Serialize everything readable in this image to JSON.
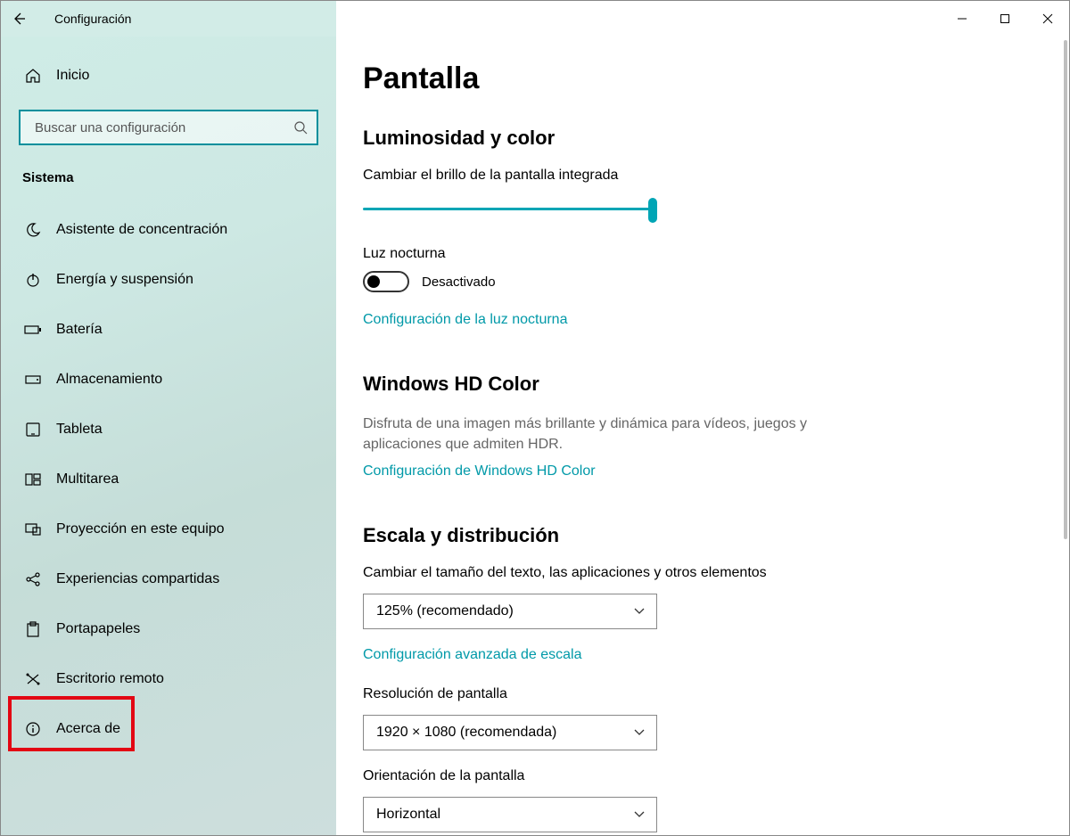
{
  "titlebar": {
    "title": "Configuración"
  },
  "sidebar": {
    "home": "Inicio",
    "search_placeholder": "Buscar una configuración",
    "category": "Sistema",
    "items": [
      {
        "label": "Asistente de concentración"
      },
      {
        "label": "Energía y suspensión"
      },
      {
        "label": "Batería"
      },
      {
        "label": "Almacenamiento"
      },
      {
        "label": "Tableta"
      },
      {
        "label": "Multitarea"
      },
      {
        "label": "Proyección en este equipo"
      },
      {
        "label": "Experiencias compartidas"
      },
      {
        "label": "Portapapeles"
      },
      {
        "label": "Escritorio remoto"
      },
      {
        "label": "Acerca de"
      }
    ]
  },
  "main": {
    "page_title": "Pantalla",
    "sec1": {
      "heading": "Luminosidad y color",
      "brightness_label": "Cambiar el brillo de la pantalla integrada",
      "nightlight_label": "Luz nocturna",
      "nightlight_state": "Desactivado",
      "nightlight_link": "Configuración de la luz nocturna"
    },
    "sec2": {
      "heading": "Windows HD Color",
      "desc": "Disfruta de una imagen más brillante y dinámica para vídeos, juegos y aplicaciones que admiten HDR.",
      "link": "Configuración de Windows HD Color"
    },
    "sec3": {
      "heading": "Escala y distribución",
      "scale_label": "Cambiar el tamaño del texto, las aplicaciones y otros elementos",
      "scale_value": "125% (recomendado)",
      "scale_link": "Configuración avanzada de escala",
      "res_label": "Resolución de pantalla",
      "res_value": "1920 × 1080 (recomendada)",
      "orient_label": "Orientación de la pantalla",
      "orient_value": "Horizontal"
    }
  }
}
